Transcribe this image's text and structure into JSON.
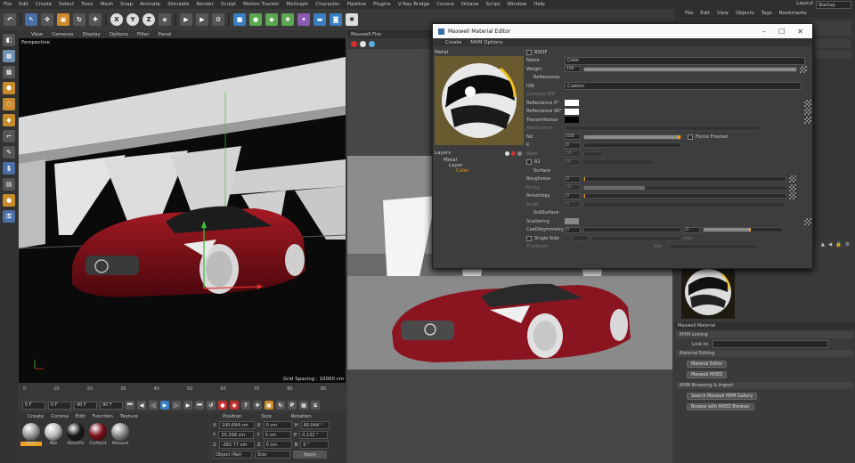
{
  "menubar": [
    "File",
    "Edit",
    "Create",
    "Select",
    "Tools",
    "Mesh",
    "Snap",
    "Animate",
    "Simulate",
    "Render",
    "Sculpt",
    "Motion Tracker",
    "MoGraph",
    "Character",
    "Pipeline",
    "Plugins",
    "V-Ray Bridge",
    "Corona",
    "Octane",
    "Script",
    "Window",
    "Help"
  ],
  "layout": {
    "label": "Layout",
    "value": "Startup"
  },
  "toolbar_axes": [
    "X",
    "Y",
    "Z"
  ],
  "viewport": {
    "menu": [
      "View",
      "Cameras",
      "Display",
      "Options",
      "Filter",
      "Panel"
    ],
    "label": "Perspective",
    "grid_spacing": "Grid Spacing : 10000 cm"
  },
  "timeline": {
    "ticks": [
      "0",
      "10",
      "20",
      "30",
      "40",
      "50",
      "60",
      "70",
      "80",
      "90"
    ],
    "end": "1 F"
  },
  "transport": {
    "start": "0 F",
    "current": "0 F",
    "end": "90 F",
    "end2": "90 F"
  },
  "material_manager": {
    "menu": [
      "Create",
      "Corona",
      "Edit",
      "Function",
      "Texture"
    ],
    "materials": [
      {
        "name": "Metal",
        "color": "#9a9a9a"
      },
      {
        "name": "Mat",
        "color": "#bdbdbd"
      },
      {
        "name": "BlackPls",
        "color": "#181818"
      },
      {
        "name": "CarPaint",
        "color": "#7a0f18"
      },
      {
        "name": "Maxwell",
        "color": "#8a8a8a"
      }
    ]
  },
  "coordinates": {
    "headers": [
      "Position",
      "Size",
      "Rotation"
    ],
    "rows": [
      {
        "axis": "X",
        "pos": "100.694 cm",
        "size": "0 cm",
        "rot_axis": "H",
        "rot": "60.044 °"
      },
      {
        "axis": "Y",
        "pos": "25.258 cm",
        "size": "0 cm",
        "rot_axis": "P",
        "rot": "0.132 °"
      },
      {
        "axis": "Z",
        "pos": "-282.77 cm",
        "size": "0 cm",
        "rot_axis": "B",
        "rot": "0 °"
      }
    ],
    "mode": "Object (Rel)",
    "size_mode": "Size",
    "apply": "Apply"
  },
  "render_panel": {
    "title": "Maxwell Fire"
  },
  "editor": {
    "title": "Maxwell Material Editor",
    "menu": [
      "Create",
      "MXM Options"
    ],
    "preview_label": "Metal",
    "layers_title": "Layers",
    "layers": [
      "Metal",
      "Layer",
      "Color"
    ],
    "bsdf_label": "BSDF",
    "name_label": "Name",
    "name_value": "Color",
    "weight_label": "Weight",
    "weight_value": "100",
    "weight_pct": 100,
    "reflectance_section": "Reflectance",
    "ior_label": "IOR",
    "ior_value": "Custom",
    "complex_ior": "Complex IOR",
    "refl0": "Reflectance 0°",
    "refl90": "Reflectance 90°",
    "transmittance": "Transmittance",
    "attenuation": "Attenuation",
    "nd_label": "Nd",
    "nd_value": "500",
    "nd_pct": 100,
    "force_fresnel": "Force Fresnel",
    "k_label": "K",
    "k_value": "0",
    "abbe_label": "Abbe",
    "abbe_value": "50",
    "r2_label": "R2",
    "r2_value": "50",
    "surface_section": "Surface",
    "roughness_label": "Roughness",
    "roughness_value": "0",
    "bump_label": "Bump",
    "bump_value": "30",
    "anisotropy_label": "Anisotropy",
    "anisotropy_value": "0",
    "angle_label": "Angle",
    "angle_value": "0",
    "subsurface_section": "SubSurface",
    "scattering_label": "Scattering",
    "coef_label": "Coef/Asymmetry",
    "coef_value": "0",
    "coef_value2": "0",
    "single_sided_label": "Single Side",
    "thickness_label": "Thickness",
    "min_label": "min",
    "max_label": "max"
  },
  "object_manager": {
    "menu": [
      "File",
      "Edit",
      "View",
      "Objects",
      "Tags",
      "Bookmarks"
    ]
  },
  "maxwell_material": {
    "title": "Maxwell Material",
    "mxm_linking": "MXM Linking",
    "link_to": "Link to",
    "material_editing": "Material Editing",
    "btn_editor": "Material Editor",
    "btn_mxed": "Maxwell MXED",
    "mxm_browsing": "MXM Browsing & Import",
    "btn_search": "Search Maxwell MXM Gallery",
    "btn_browse": "Browse with MXED Browser"
  },
  "colors": {
    "accent_orange": "#f0a020",
    "car_red": "#8a0f18",
    "selection_blue": "#3b6ea8"
  }
}
